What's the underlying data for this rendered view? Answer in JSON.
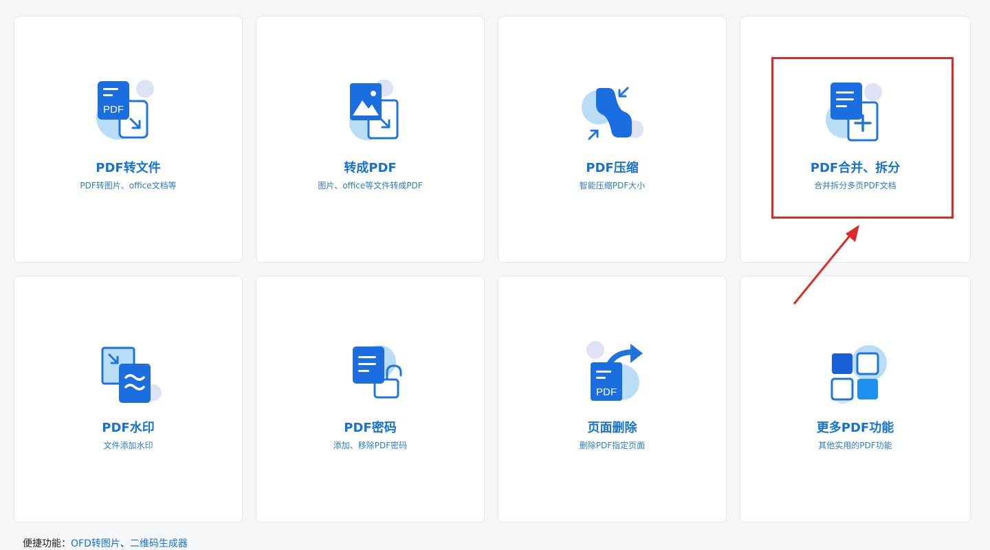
{
  "cards": [
    {
      "title": "PDF转文件",
      "desc": "PDF转图片、office文档等",
      "icon": "pdf-to-file-icon"
    },
    {
      "title": "转成PDF",
      "desc": "图片、office等文件转成PDF",
      "icon": "convert-to-pdf-icon"
    },
    {
      "title": "PDF压缩",
      "desc": "智能压缩PDF大小",
      "icon": "compress-icon"
    },
    {
      "title": "PDF合并、拆分",
      "desc": "合并拆分多页PDF文档",
      "icon": "merge-split-icon"
    },
    {
      "title": "PDF水印",
      "desc": "文件添加水印",
      "icon": "watermark-icon"
    },
    {
      "title": "PDF密码",
      "desc": "添加、移除PDF密码",
      "icon": "password-lock-icon"
    },
    {
      "title": "页面删除",
      "desc": "删除PDF指定页面",
      "icon": "page-delete-icon"
    },
    {
      "title": "更多PDF功能",
      "desc": "其他实用的PDF功能",
      "icon": "more-grid-icon"
    }
  ],
  "icon_labels": {
    "pdf": "PDF"
  },
  "footer": {
    "label": "便捷功能：",
    "links": [
      "OFD转图片",
      "二维码生成器"
    ],
    "separator": "、"
  },
  "colors": {
    "primary": "#1572d3",
    "highlight": "#e02a25"
  }
}
